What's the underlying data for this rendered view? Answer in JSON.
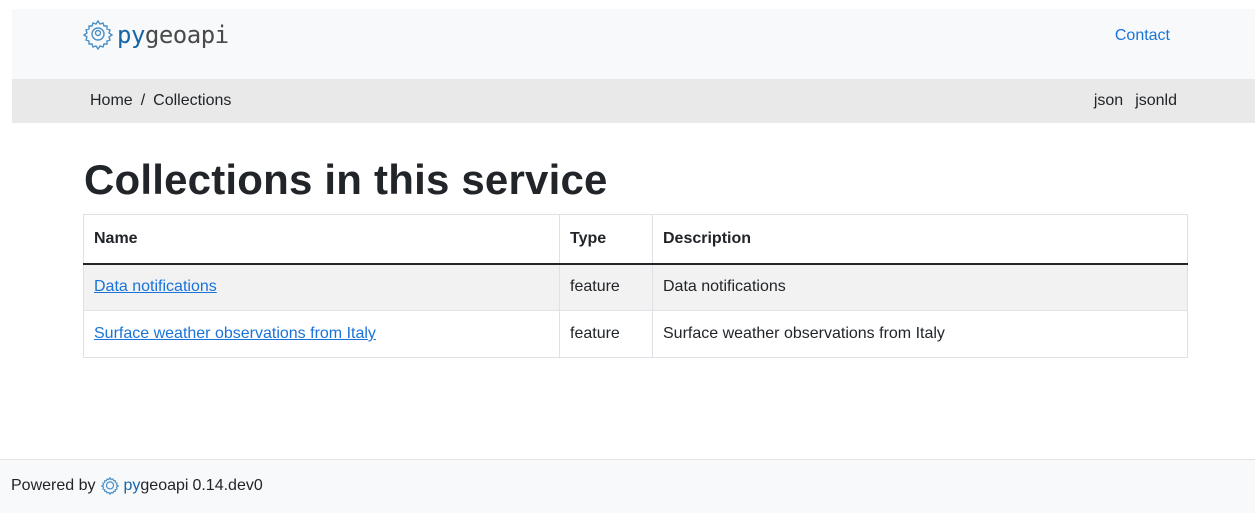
{
  "header": {
    "logo_prefix": "py",
    "logo_suffix": "geoapi",
    "contact_label": "Contact"
  },
  "breadcrumb": {
    "home": "Home",
    "separator": "/",
    "current": "Collections"
  },
  "formats": [
    "json",
    "jsonld"
  ],
  "page": {
    "title": "Collections in this service"
  },
  "table": {
    "headers": [
      "Name",
      "Type",
      "Description"
    ],
    "rows": [
      {
        "name": "Data notifications",
        "type": "feature",
        "description": "Data notifications"
      },
      {
        "name": "Surface weather observations from Italy",
        "type": "feature",
        "description": "Surface weather observations from Italy"
      }
    ]
  },
  "footer": {
    "powered_by": "Powered by",
    "logo_prefix": "py",
    "logo_suffix": "geoapi",
    "version": "0.14.dev0"
  },
  "colors": {
    "link": "#1a73d9",
    "brand_blue": "#1565a8",
    "header_bg": "#f8f9fa",
    "breadcrumb_bg": "#e9e9e9"
  },
  "icons": {
    "logo": "gear-location-icon"
  }
}
